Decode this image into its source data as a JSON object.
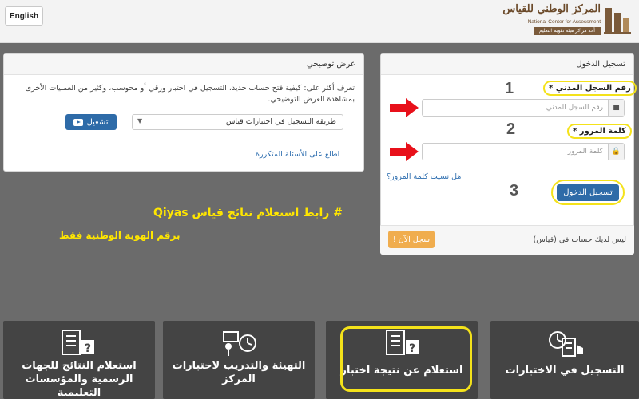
{
  "header": {
    "lang_button": "English",
    "logo_ar": "المركز الوطني للقياس",
    "logo_en": "National Center for Assessment",
    "logo_tag": "أحد مراكز هيئة تقويم التعليم"
  },
  "demo_panel": {
    "title": "عرض توضيحي",
    "description": "تعرف أكثر على: كيفية فتح حساب جديد، التسجيل في اختبار ورقي أو محوسب، وكثير من العمليات الأخرى بمشاهدة العرض التوضيحي.",
    "select_value": "طريقة التسجيل في اختبارات قياس",
    "play_label": "تشغيل",
    "faq_link": "اطلع على الأسئلة المتكررة"
  },
  "login_panel": {
    "title": "تسجيل الدخول",
    "id_label": "رقم السجل المدني *",
    "id_placeholder": "رقم السجل المدني",
    "password_label": "كلمة المرور *",
    "password_placeholder": "كلمة المرور",
    "forgot_link": "هل نسيت كلمة المرور؟",
    "login_button": "تسجيل الدخول",
    "no_account": "ليس لديك حساب في (قياس)",
    "register_button": "سجل الآن !",
    "steps": [
      "1",
      "2",
      "3"
    ]
  },
  "annotation": {
    "line1": "# رابط استعلام نتائج قياس Qiyas",
    "line2": "برقم الهوية الوطنية فقط",
    "highlight_color": "#f4e21a",
    "text_color": "#ffe600",
    "arrow_color": "#e8101a"
  },
  "cards": [
    {
      "title": "استعلام النتائج للجهات الرسمية والمؤسسات التعليمية",
      "icon": "checklist-question-icon"
    },
    {
      "title": "التهيئة والتدريب لاختبارات المركز",
      "icon": "training-clock-icon"
    },
    {
      "title": "استعلام عن نتيجة اختبار",
      "icon": "checklist-question-icon"
    },
    {
      "title": "التسجيل في الاختبارات",
      "icon": "clock-checklist-hand-icon"
    }
  ]
}
